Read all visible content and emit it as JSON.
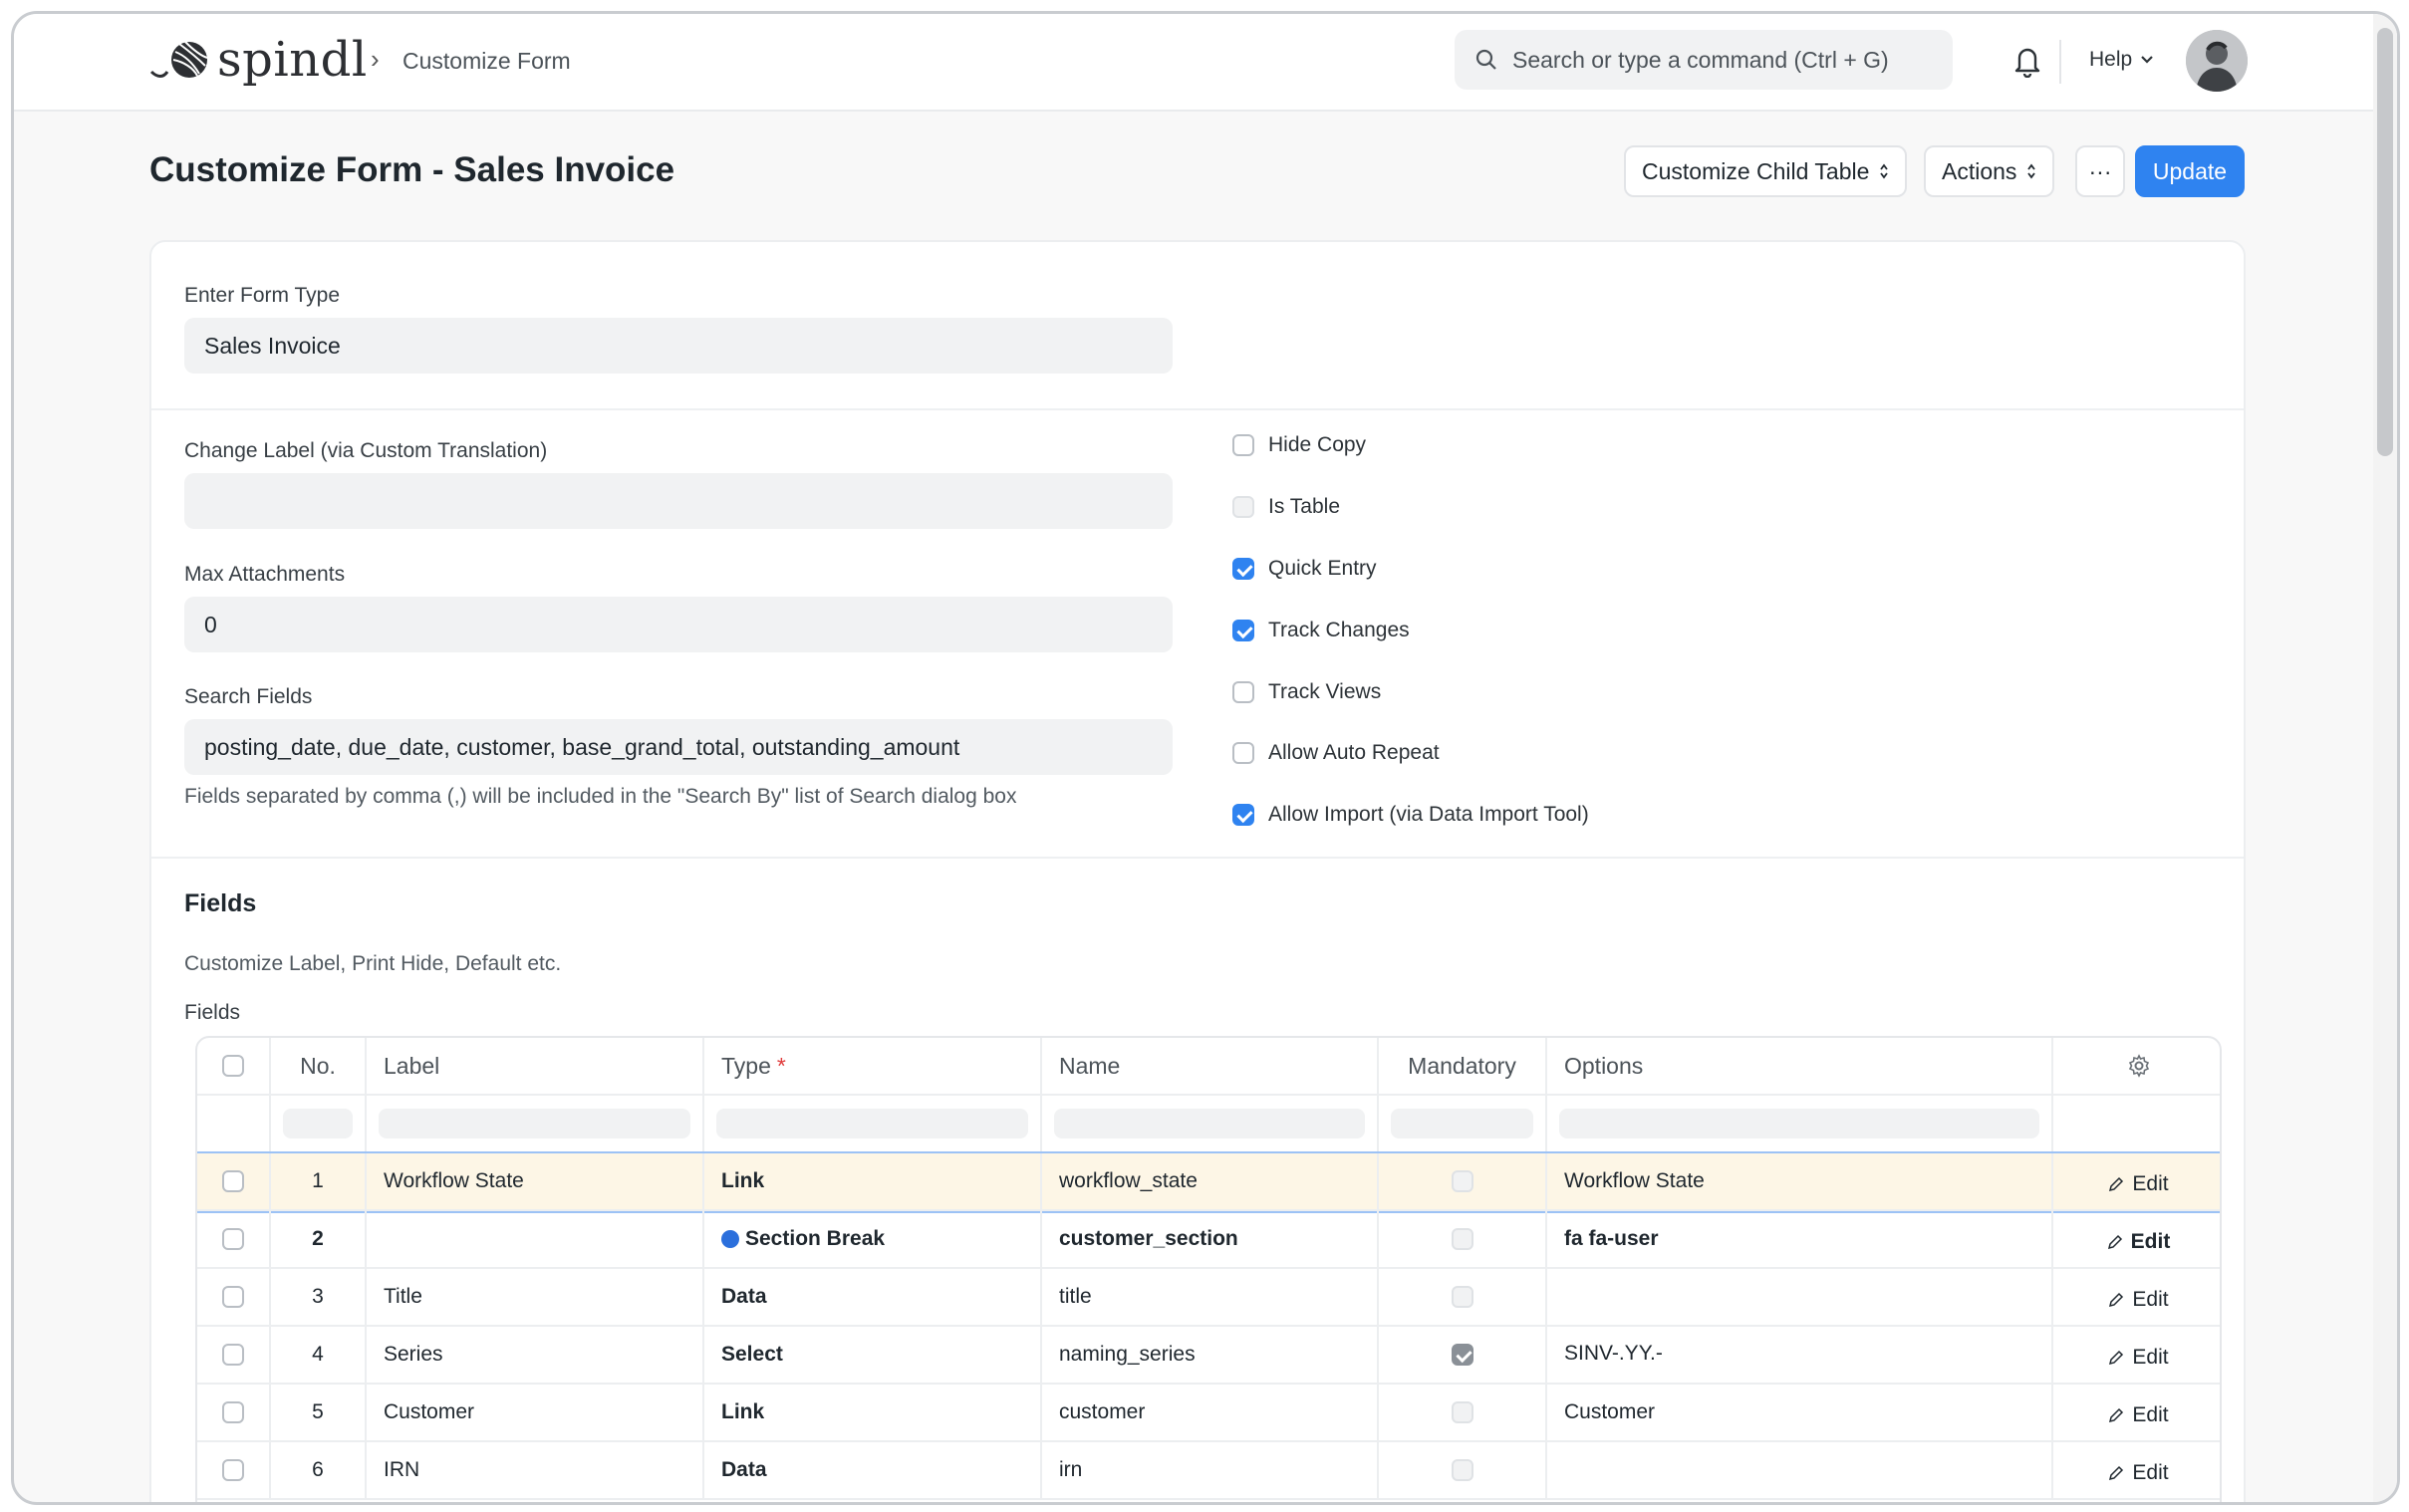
{
  "app": {
    "logo_text": "spindl"
  },
  "breadcrumb": {
    "current": "Customize Form"
  },
  "search": {
    "placeholder": "Search or type a command (Ctrl + G)"
  },
  "help": {
    "label": "Help"
  },
  "page": {
    "title": "Customize Form - Sales Invoice"
  },
  "toolbar": {
    "customize_child_table": "Customize Child Table",
    "actions": "Actions",
    "more": "···",
    "update": "Update"
  },
  "form": {
    "form_type_label": "Enter Form Type",
    "form_type_value": "Sales Invoice",
    "change_label_label": "Change Label (via Custom Translation)",
    "change_label_value": "",
    "max_attachments_label": "Max Attachments",
    "max_attachments_value": "0",
    "search_fields_label": "Search Fields",
    "search_fields_value": "posting_date, due_date, customer, base_grand_total, outstanding_amount",
    "search_fields_help": "Fields separated by comma (,) will be included in the \"Search By\" list of Search dialog box"
  },
  "checks": [
    {
      "label": "Hide Copy",
      "state": "unchecked"
    },
    {
      "label": "Is Table",
      "state": "disabled"
    },
    {
      "label": "Quick Entry",
      "state": "checked"
    },
    {
      "label": "Track Changes",
      "state": "checked"
    },
    {
      "label": "Track Views",
      "state": "unchecked"
    },
    {
      "label": "Allow Auto Repeat",
      "state": "unchecked"
    },
    {
      "label": "Allow Import (via Data Import Tool)",
      "state": "checked"
    }
  ],
  "fields_section": {
    "title": "Fields",
    "description": "Customize Label, Print Hide, Default etc.",
    "grid_label": "Fields"
  },
  "grid": {
    "headers": {
      "no": "No.",
      "label": "Label",
      "type": "Type",
      "required_mark": "*",
      "name": "Name",
      "mandatory": "Mandatory",
      "options": "Options"
    },
    "edit_label": "Edit",
    "rows": [
      {
        "no": "1",
        "label": "Workflow State",
        "type": "Link",
        "name": "workflow_state",
        "mandatory": false,
        "options": "Workflow State",
        "bold": false
      },
      {
        "no": "2",
        "label": "",
        "type": "Section Break",
        "name": "customer_section",
        "mandatory": false,
        "options": "fa fa-user",
        "bold": true
      },
      {
        "no": "3",
        "label": "Title",
        "type": "Data",
        "name": "title",
        "mandatory": false,
        "options": "",
        "bold": false
      },
      {
        "no": "4",
        "label": "Series",
        "type": "Select",
        "name": "naming_series",
        "mandatory": true,
        "options": "SINV-.YY.-",
        "bold": false
      },
      {
        "no": "5",
        "label": "Customer",
        "type": "Link",
        "name": "customer",
        "mandatory": false,
        "options": "Customer",
        "bold": false
      },
      {
        "no": "6",
        "label": "IRN",
        "type": "Data",
        "name": "irn",
        "mandatory": false,
        "options": "",
        "bold": false
      }
    ]
  },
  "colors": {
    "primary": "#2f83f0",
    "section_dot": "#2b6fdc",
    "active_row": "#fdf6e6"
  }
}
